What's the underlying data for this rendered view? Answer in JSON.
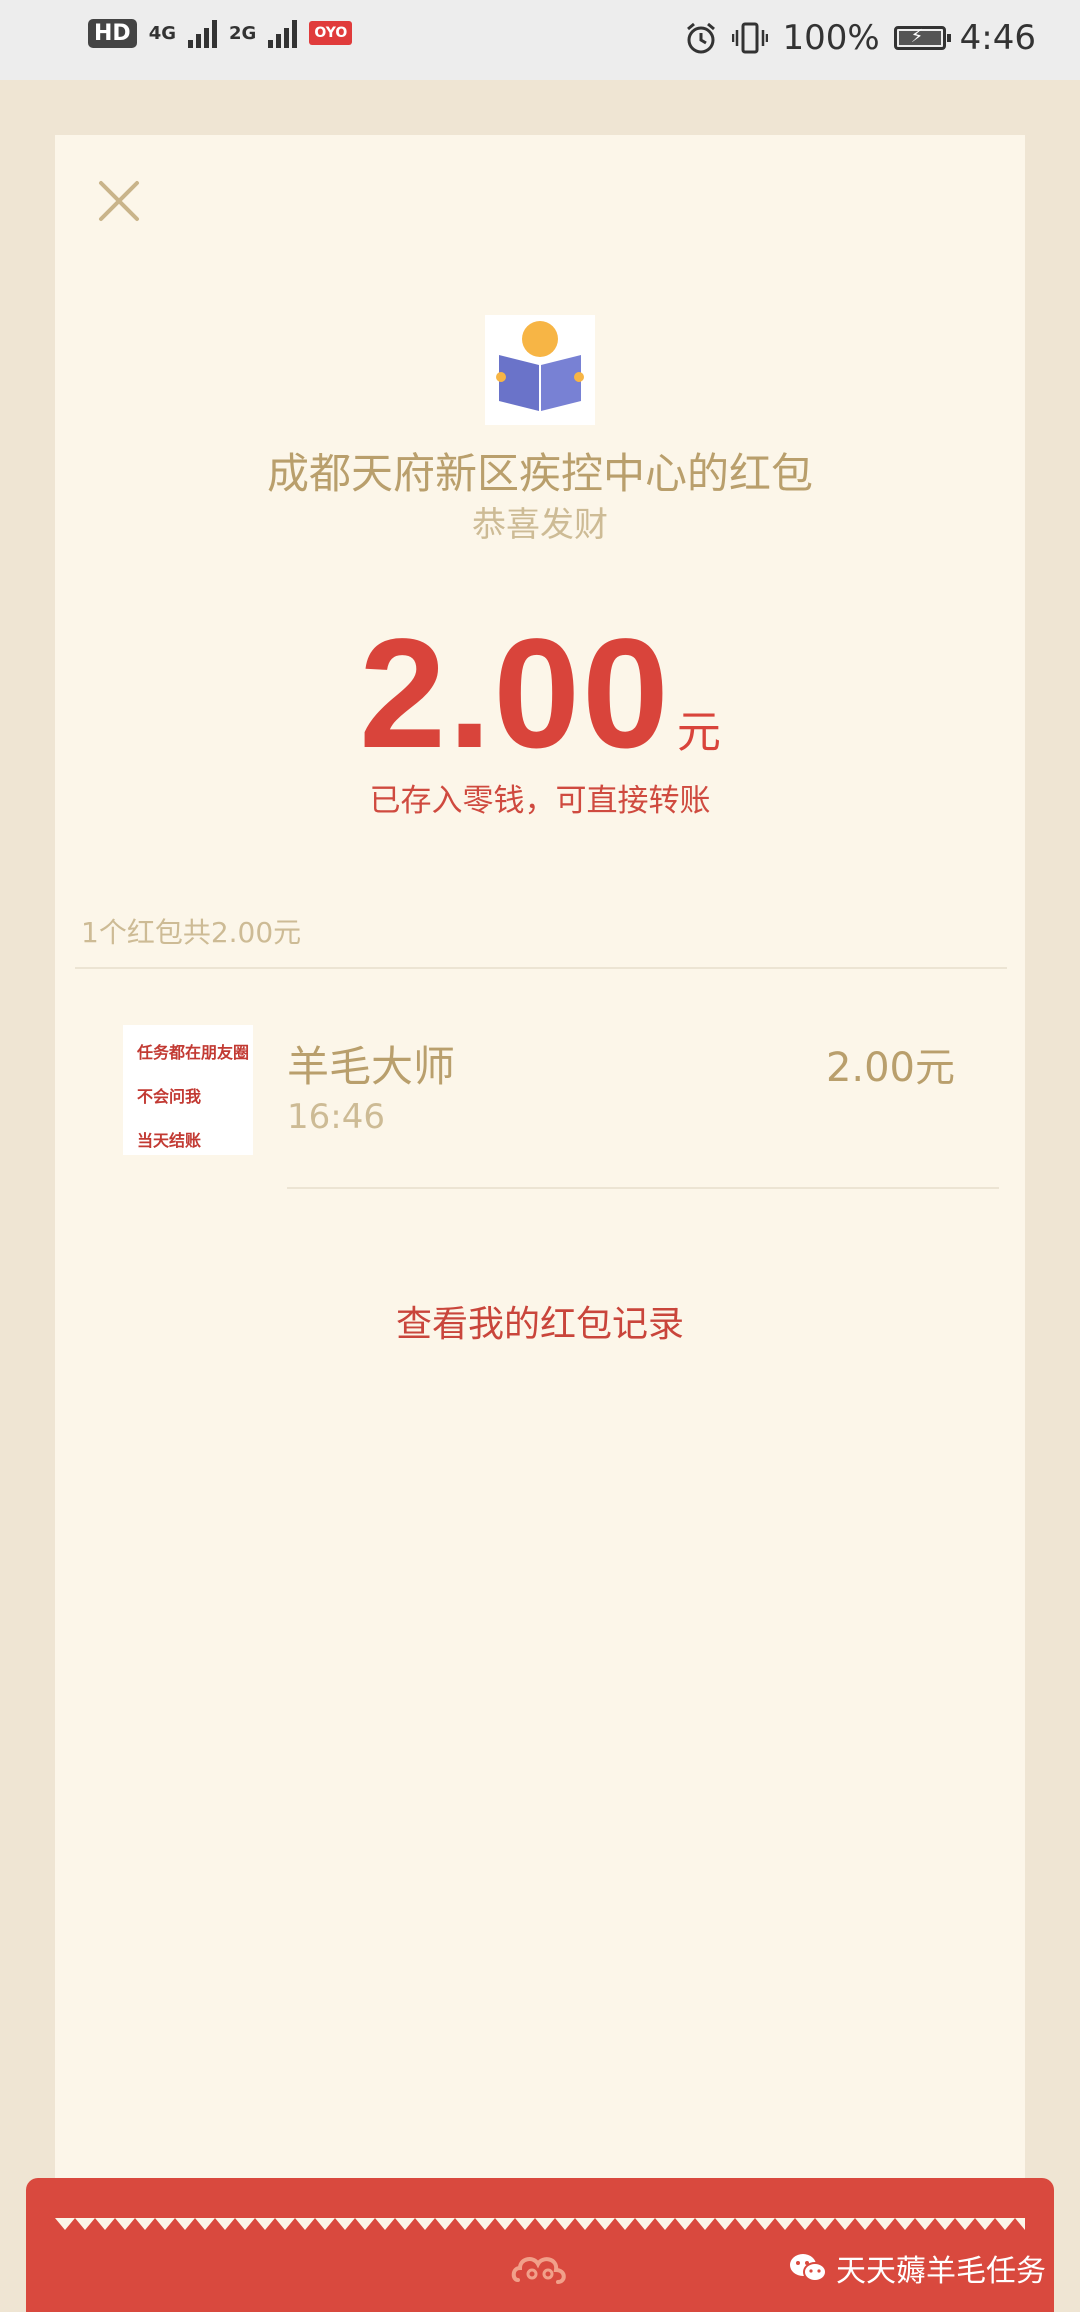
{
  "status_bar": {
    "hd_label": "HD",
    "net1_label": "4G",
    "net2_label": "2G",
    "carrier_badge": "OYO",
    "battery_percent": "100%",
    "time": "4:46"
  },
  "envelope": {
    "sender_title": "成都天府新区疾控中心的红包",
    "subtitle": "恭喜发财",
    "amount": "2.00",
    "amount_unit": "元",
    "saved_note": "已存入零钱，可直接转账",
    "summary": "1个红包共2.00元"
  },
  "receiver": {
    "name": "羊毛大师",
    "time": "16:46",
    "amount": "2.00元",
    "avatar_lines": [
      "任务都在朋友圈",
      "不会问我",
      "当天结账"
    ]
  },
  "actions": {
    "record_link": "查看我的红包记录"
  },
  "watermark": {
    "text": "天天薅羊毛任务"
  },
  "colors": {
    "accent_red": "#d9443b",
    "gold_text": "#b99f6c",
    "card_bg": "#fcf6e9"
  }
}
